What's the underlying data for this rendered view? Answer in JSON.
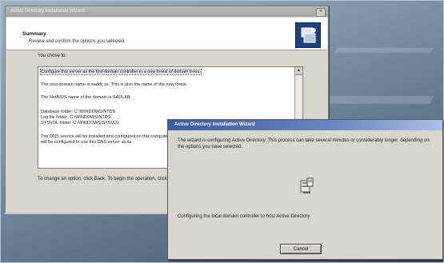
{
  "back_window": {
    "title": "Active Directory Installation Wizard",
    "close_glyph": "×",
    "header_title": "Summary",
    "header_subtitle": "Review and confirm the options you selected.",
    "options_label": "You chose to:",
    "summary_lines": [
      "Configure this server as the first domain controller in a new forest of domain trees.",
      "The new domain name is xaddc.ss. This is also the name of the new forest.",
      "The NetBIOS name of the domain is SADLAB.",
      "Database folder: C:\\WINDOWS\\NTDS",
      "Log file folder: C:\\WINDOWS\\NTDS",
      "SYSVOL folder: C:\\WINDOWS\\SYSVOL",
      "The DNS service will be installed and configured on this computer.",
      "will be configured to use this DNS server as its"
    ],
    "footer_text": "To change an option, click Back. To begin the operation, click Next."
  },
  "front_window": {
    "title": "Active Directory Installation Wizard",
    "message": "The wizard is configuring Active Directory. This process can take several minutes or considerably longer, depending on the options you have selected.",
    "status": "Configuring the local domain controller to host Active Directory",
    "cancel_label": "Cancel",
    "icon": "wizard-server-icon"
  },
  "colors": {
    "title_active": "#3a5aa0",
    "title_inactive": "#a5a5a5",
    "dialog_bg": "#d9d6ce",
    "desktop": "#5c7088"
  }
}
